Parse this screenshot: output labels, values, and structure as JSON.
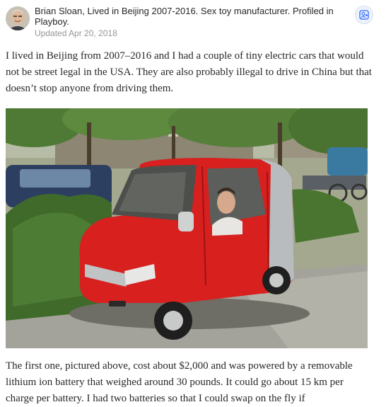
{
  "answer": {
    "author": {
      "name": "Brian Sloan",
      "credential": ", Lived in Beijing 2007-2016. Sex toy manufacturer. Profiled in Playboy.",
      "updated": "Updated Apr 20, 2018",
      "follow_icon": "follow-user-icon"
    },
    "paragraph1": "I lived in Beijing from 2007–2016 and I had a couple of tiny electric cars that would not be street legal in the USA. They are also probably illegal to drive in China but that doesn’t stop anyone from driving them.",
    "paragraph2": "The first one, pictured above, cost about $2,000 and was powered by a removable lithium ion battery that weighed around 30 pounds. It could go about 15 km per charge per battery. I had two batteries so that I could swap on the fly if"
  },
  "colors": {
    "car_red": "#d8201f",
    "car_grey": "#b9bcbe",
    "foliage": "#3f6a2a",
    "road": "#9a9a94"
  }
}
